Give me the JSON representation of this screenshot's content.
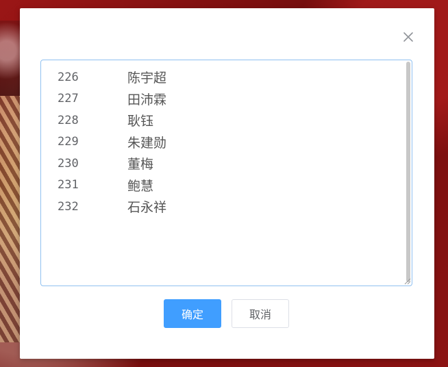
{
  "dialog": {
    "close_icon": "close-icon",
    "list": [
      {
        "num": "226",
        "name": "陈宇超"
      },
      {
        "num": "227",
        "name": "田沛霖"
      },
      {
        "num": "228",
        "name": "耿钰"
      },
      {
        "num": "229",
        "name": "朱建勋"
      },
      {
        "num": "230",
        "name": "董梅"
      },
      {
        "num": "231",
        "name": "鲍慧"
      },
      {
        "num": "232",
        "name": "石永祥"
      }
    ],
    "buttons": {
      "ok_label": "确定",
      "cancel_label": "取消"
    }
  },
  "colors": {
    "primary": "#409eff",
    "border": "#8fc0f0"
  }
}
